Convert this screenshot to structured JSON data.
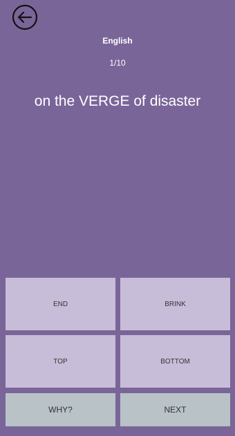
{
  "header": {
    "back_icon": "arrow-left-circle-icon",
    "language": "English",
    "progress": "1/10"
  },
  "quiz": {
    "question": "on the VERGE of disaster",
    "answers": [
      "END",
      "BRINK",
      "TOP",
      "BOTTOM"
    ]
  },
  "actions": {
    "why_label": "WHY?",
    "next_label": "NEXT"
  },
  "colors": {
    "background": "#7a6599",
    "answer_button": "#c8bdd8",
    "action_button": "#b9c2c7",
    "text_light": "#ffffff",
    "text_dark": "#333333"
  }
}
